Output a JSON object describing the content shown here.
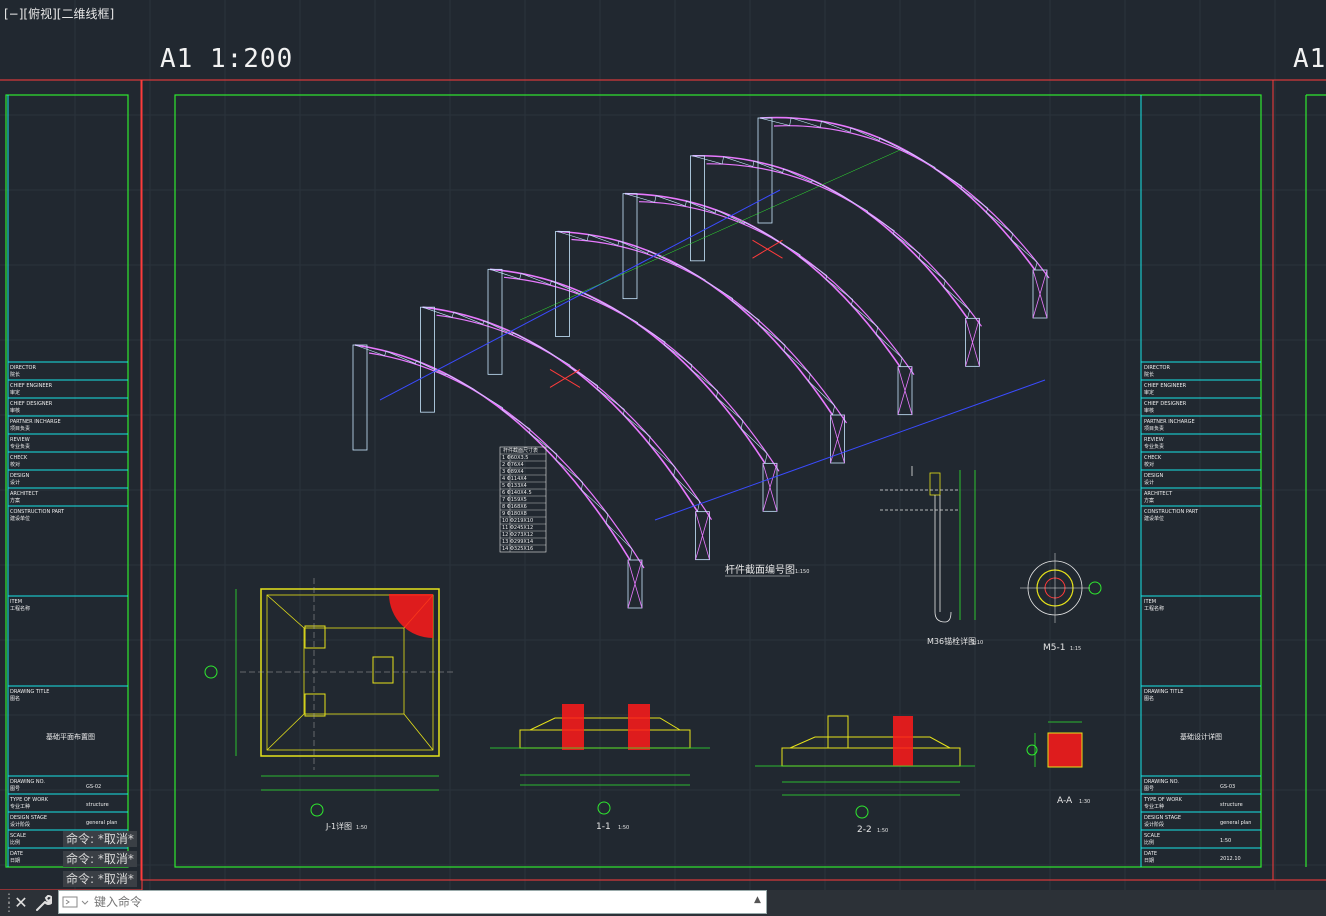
{
  "viewport": {
    "label": "[−][俯视][二维线框]"
  },
  "sheets": {
    "left_label": "A1  1:200",
    "right_label": "A1"
  },
  "colors": {
    "background": "#212830",
    "frame_red": "#ff3b3b",
    "frame_green": "#2fe82f",
    "title_cyan": "#17e4e6",
    "truss_magenta": "#e879ff",
    "rebar_red": "#ff1a1a",
    "column_yellow": "#e6e21a"
  },
  "title_block_rows": [
    {
      "en": "DIRECTOR",
      "cn": "院长"
    },
    {
      "en": "CHIEF ENGINEER",
      "cn": "审定"
    },
    {
      "en": "CHIEF DESIGNER",
      "cn": "审核"
    },
    {
      "en": "PARTNER INCHARGE",
      "cn": "项目负责"
    },
    {
      "en": "REVIEW",
      "cn": "专业负责"
    },
    {
      "en": "CHECK",
      "cn": "校对"
    },
    {
      "en": "DESIGN",
      "cn": "设计"
    },
    {
      "en": "ARCHITECT",
      "cn": "方案"
    },
    {
      "en": "CONSTRUCTION PART",
      "cn": "建设单位"
    }
  ],
  "title_block_item": {
    "en": "ITEM",
    "cn": "工程名称"
  },
  "title_block_drawing_title": {
    "en": "DRAWING TITLE",
    "cn": "图名"
  },
  "left_title_block": {
    "drawing_title": "基础平面布置图",
    "drawing_no": "GS-02",
    "type_of_work": "structure",
    "design_stage": "general plan",
    "scale": "",
    "date": ""
  },
  "right_title_block": {
    "drawing_title": "基础设计详图",
    "drawing_no": "GS-03",
    "type_of_work": "structure",
    "design_stage": "general plan",
    "scale": "1:50",
    "date": "2012.10"
  },
  "info_labels": {
    "drawing_no": {
      "en": "DRAWING NO.",
      "cn": "图号"
    },
    "type_of_work": {
      "en": "TYPE OF WORK",
      "cn": "专业工种"
    },
    "design_stage": {
      "en": "DESIGN STAGE",
      "cn": "设计阶段"
    },
    "scale": {
      "en": "SCALE",
      "cn": "比例"
    },
    "date": {
      "en": "DATE",
      "cn": "日期"
    }
  },
  "captions": {
    "truss_section": "杆件截面编号图",
    "truss_section_scale": "1:150",
    "anchor_bolt": "M36锚栓详图",
    "anchor_bolt_scale": "1:10",
    "plate": "M5-1",
    "plate_scale": "1:15",
    "j1": "J-1详图",
    "j1_scale": "1:50",
    "sec11": "1-1",
    "sec11_scale": "1:50",
    "sec22": "2-2",
    "sec22_scale": "1:50",
    "secAA": "A-A",
    "secAA_scale": "1:30"
  },
  "member_table": {
    "header": "杆件截面尺寸表",
    "rows": [
      "1 Φ60X3.5",
      "2 Φ76X4",
      "3 Φ89X4",
      "4 Φ114X4",
      "5 Φ133X4",
      "6 Φ140X4.5",
      "7 Φ159X5",
      "8 Φ168X6",
      "9 Φ180X8",
      "10 Φ219X10",
      "11 Φ245X12",
      "12 Φ273X12",
      "13 Φ299X14",
      "14 Φ325X16"
    ]
  },
  "command_history": [
    "命令: *取消*",
    "命令: *取消*",
    "命令: *取消*"
  ],
  "command_input": {
    "placeholder": "键入命令"
  },
  "icons": {
    "close": "close-icon",
    "wrench": "wrench-icon",
    "grip": "grip-icon",
    "prompt": "command-prompt-icon",
    "up": "chevron-up-icon"
  }
}
